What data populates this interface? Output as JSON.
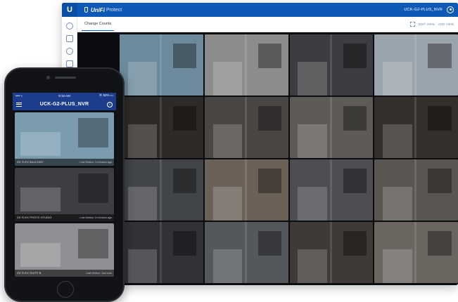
{
  "desktop": {
    "brand": {
      "unifi": "UniFi",
      "product": "Protect"
    },
    "nvr_name": "UCK-G2-PLUS_NVR",
    "tab_label": "Change Counts",
    "actions": {
      "edit_view": "EDIT VIEW",
      "add_view": "ADD VIEW"
    },
    "cameras": [
      {
        "bg": "#6d8a9c"
      },
      {
        "bg": "#8c8c8c"
      },
      {
        "bg": "#3b3d40"
      },
      {
        "bg": "#9aa4ad"
      },
      {
        "bg": "#2e2a27"
      },
      {
        "bg": "#4a4644"
      },
      {
        "bg": "#5e5b57"
      },
      {
        "bg": "#352f2b"
      },
      {
        "bg": "#424548"
      },
      {
        "bg": "#6b6157"
      },
      {
        "bg": "#4c4e52"
      },
      {
        "bg": "#5a5550"
      },
      {
        "bg": "#303236"
      },
      {
        "bg": "#54575b"
      },
      {
        "bg": "#3f3a36"
      },
      {
        "bg": "#6a655e"
      }
    ]
  },
  "phone": {
    "status": {
      "signal": "•••• ≈",
      "time": "9:16 AM",
      "battery": "⦿ 82% ▭"
    },
    "title": "UCK-G2-PLUS_NVR",
    "info_glyph": "i",
    "feeds": [
      {
        "name": "G3 FLEX BALCONY",
        "meta": "Last Motion: 3 minutes ago",
        "bg": "#7a9cae"
      },
      {
        "name": "G3 FLEX PHOTO STUDIO",
        "meta": "Last Motion: 5 minutes ago",
        "bg": "#3c3e42"
      },
      {
        "name": "G3 FLEX SUITE B",
        "meta": "Last Motion: Just now",
        "bg": "#8e8f92"
      }
    ]
  },
  "colors": {
    "accent": "#0f59b6",
    "phone_header": "#1c3c8c"
  }
}
